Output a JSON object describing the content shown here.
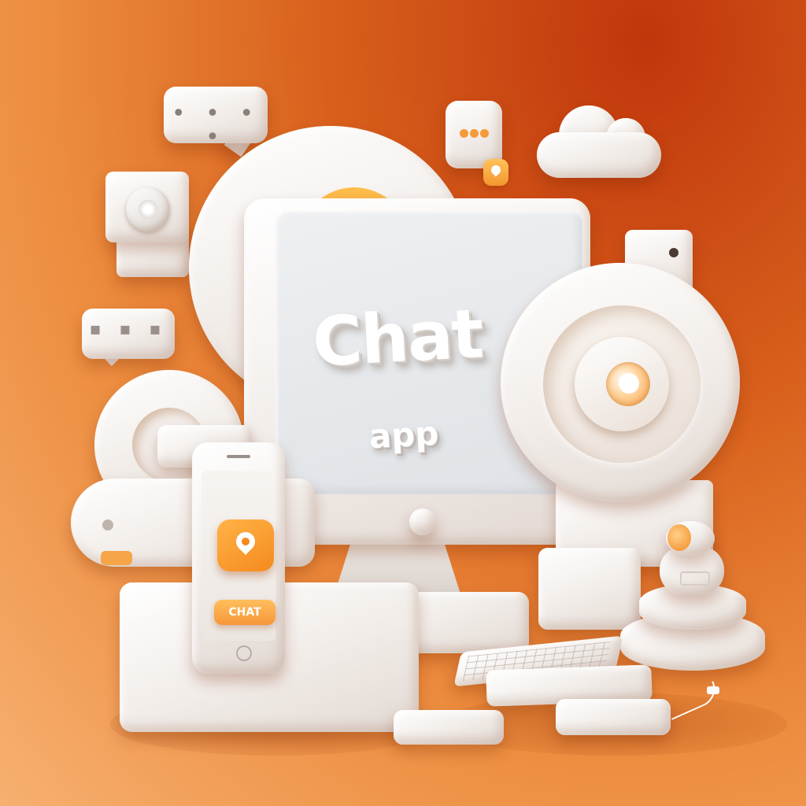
{
  "scene": {
    "title": "Chat",
    "subtitle": "app",
    "phone_button_label": "CHAT",
    "bubble_dots": "• • • •",
    "bubble_left_dots": "▪ ▪ ▪"
  },
  "colors": {
    "background_top": "#c0360c",
    "background_bottom": "#f7b070",
    "accent_orange": "#f58a1f",
    "object_white": "#f1ece8"
  },
  "icons": [
    "chat-bubble-icon",
    "cloud-icon",
    "webcam-icon",
    "location-pin-icon",
    "robot-icon",
    "keyboard-icon",
    "mouse-icon",
    "smartphone-icon",
    "monitor-icon"
  ]
}
